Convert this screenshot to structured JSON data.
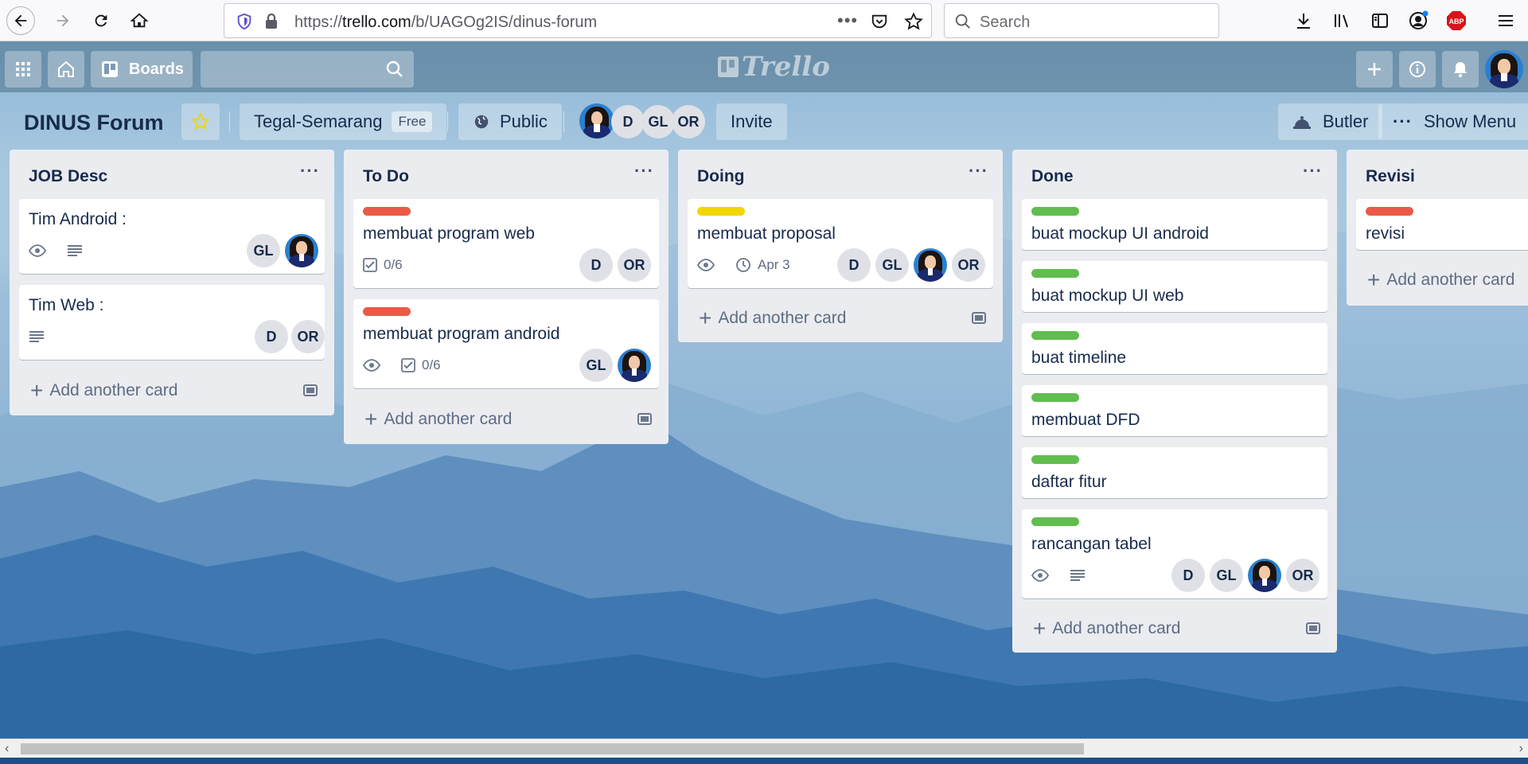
{
  "browser": {
    "url_prefix": "https://",
    "url_host": "trello.com",
    "url_path": "/b/UAGOg2IS/dinus-forum",
    "search_placeholder": "Search",
    "ellipsis": "•••"
  },
  "header": {
    "boards_label": "Boards",
    "logo_text": "Trello"
  },
  "board": {
    "title": "DINUS Forum",
    "team": "Tegal-Semarang",
    "plan": "Free",
    "visibility": "Public",
    "members": [
      "D",
      "GL",
      "OR"
    ],
    "invite_label": "Invite",
    "butler_label": "Butler",
    "menu_label": "Show Menu"
  },
  "add_card_label": "Add another card",
  "lists": [
    {
      "title": "JOB Desc",
      "cards": [
        {
          "title": "Tim Android :",
          "members": [
            "GL",
            "photo"
          ]
        },
        {
          "title": "Tim Web :",
          "members": [
            "D",
            "OR"
          ]
        }
      ]
    },
    {
      "title": "To Do",
      "cards": [
        {
          "title": "membuat program web",
          "checklist": "0/6",
          "members": [
            "D",
            "OR"
          ]
        },
        {
          "title": "membuat program android",
          "checklist": "0/6",
          "members": [
            "GL",
            "photo"
          ]
        }
      ]
    },
    {
      "title": "Doing",
      "cards": [
        {
          "title": "membuat proposal",
          "due": "Apr 3",
          "members": [
            "D",
            "GL",
            "photo",
            "OR"
          ]
        }
      ]
    },
    {
      "title": "Done",
      "cards": [
        {
          "title": "buat mockup UI android"
        },
        {
          "title": "buat mockup UI web"
        },
        {
          "title": "buat timeline"
        },
        {
          "title": "membuat DFD"
        },
        {
          "title": "daftar fitur"
        },
        {
          "title": "rancangan tabel",
          "members": [
            "D",
            "GL",
            "photo",
            "OR"
          ]
        }
      ]
    },
    {
      "title": "Revisi",
      "cards": [
        {
          "title": "revisi"
        }
      ]
    }
  ],
  "colors": {
    "label_red": "#eb5a46",
    "label_yellow": "#f2d600",
    "label_green": "#61bd4f",
    "list_bg": "#ebecf0",
    "text": "#172b4d"
  }
}
